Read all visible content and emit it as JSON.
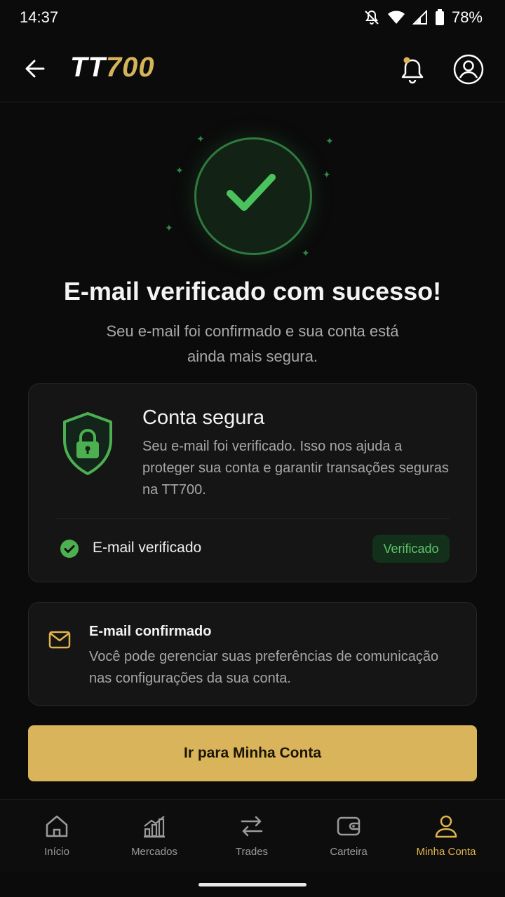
{
  "status_bar": {
    "time": "14:37",
    "battery": "78%",
    "icons": [
      "mute-bell-icon",
      "wifi-icon",
      "signal-icon",
      "battery-icon"
    ]
  },
  "header": {
    "logo_white": "TT",
    "logo_gold": "700",
    "icons": [
      "back-arrow-icon",
      "bell-icon",
      "account-icon"
    ]
  },
  "hero": {
    "title": "E-mail verificado com sucesso!",
    "subtitle": "Seu e-mail foi confirmado e sua conta está ainda mais segura."
  },
  "secure_card": {
    "title": "Conta segura",
    "text": "Seu e-mail foi verificado. Isso nos ajuda a proteger sua conta e garantir transações seguras na TT700.",
    "status_label": "E-mail verificado",
    "badge": "Verificado"
  },
  "email_card": {
    "title": "E-mail confirmado",
    "text": "Você pode gerenciar suas preferências de comunicação nas configurações da sua conta."
  },
  "primary_button": {
    "label": "Ir para Minha Conta"
  },
  "bottom_nav": {
    "items": [
      {
        "label": "Início",
        "icon": "home-icon"
      },
      {
        "label": "Mercados",
        "icon": "chart-icon"
      },
      {
        "label": "Trades",
        "icon": "swap-icon"
      },
      {
        "label": "Carteira",
        "icon": "wallet-icon"
      },
      {
        "label": "Minha Conta",
        "icon": "user-icon",
        "active": true
      }
    ]
  },
  "colors": {
    "accent": "#d9b45b",
    "success": "#4caf50",
    "background": "#0b0b0b",
    "card": "#151515"
  }
}
